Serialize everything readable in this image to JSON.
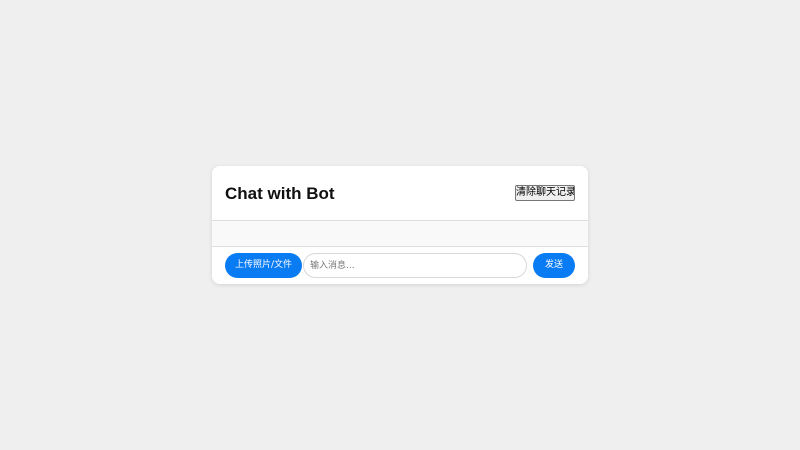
{
  "header": {
    "title": "Chat with Bot",
    "clear_label": "清除聊天记录"
  },
  "messages": [],
  "composer": {
    "upload_label": "上传照片/文件",
    "input_value": "",
    "input_placeholder": "输入消息...",
    "send_label": "发送"
  },
  "colors": {
    "page_background": "#efefef",
    "card_background": "#ffffff",
    "messages_background": "#f9f9f9",
    "accent": "#0a7cf3",
    "divider": "#dddddd"
  }
}
